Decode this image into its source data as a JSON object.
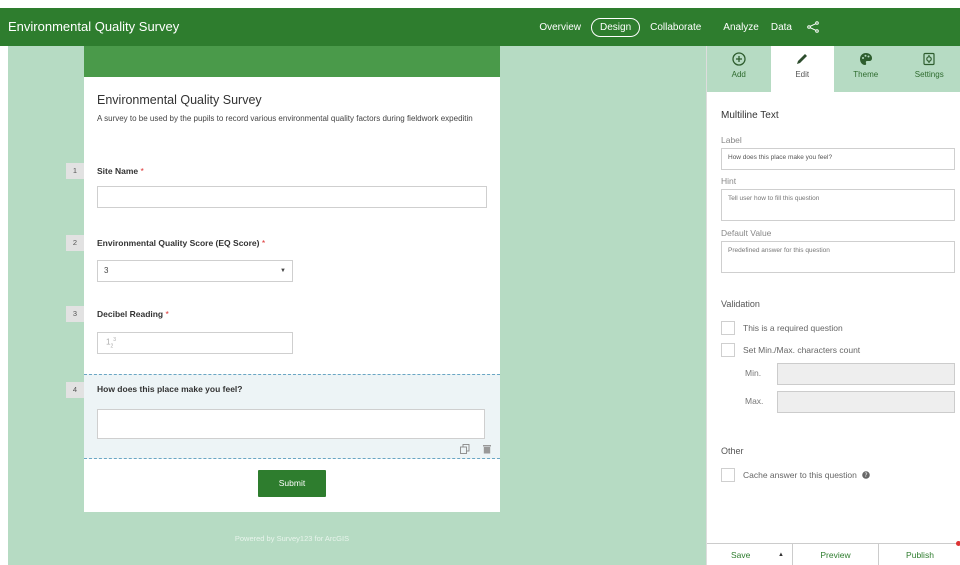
{
  "app": {
    "title": "Environmental Quality Survey"
  },
  "nav": {
    "items": [
      "Overview",
      "Design",
      "Collaborate",
      "Analyze",
      "Data"
    ],
    "active": "Design"
  },
  "form": {
    "title": "Environmental Quality Survey",
    "description": "A survey to be used by the pupils to record various environmental quality factors during fieldwork expeditin",
    "questions": [
      {
        "number": "1",
        "label": "Site Name",
        "required_marker": "*"
      },
      {
        "number": "2",
        "label": "Environmental Quality Score (EQ Score)",
        "required_marker": "*",
        "selected_value": "3"
      },
      {
        "number": "3",
        "label": "Decibel Reading",
        "required_marker": "*",
        "icon": "number-icon"
      },
      {
        "number": "4",
        "label": "How does this place make you feel?"
      }
    ],
    "submit_label": "Submit",
    "powered_by": "Powered by Survey123 for ArcGIS"
  },
  "panel": {
    "tabs": [
      {
        "label": "Add",
        "icon": "plus-circle-icon"
      },
      {
        "label": "Edit",
        "icon": "pencil-icon"
      },
      {
        "label": "Theme",
        "icon": "palette-icon"
      },
      {
        "label": "Settings",
        "icon": "settings-icon"
      }
    ],
    "active_tab": "Edit",
    "section_title": "Multiline Text",
    "label_caption": "Label",
    "label_value": "How does this place make you feel?",
    "hint_caption": "Hint",
    "hint_placeholder": "Tell user how to fill this question",
    "default_caption": "Default Value",
    "default_placeholder": "Predefined answer for this question",
    "validation_title": "Validation",
    "required_check_label": "This is a required question",
    "minmax_check_label": "Set Min./Max. characters count",
    "min_label": "Min.",
    "max_label": "Max.",
    "other_title": "Other",
    "cache_check_label": "Cache answer to this question"
  },
  "bottombar": {
    "save": "Save",
    "preview": "Preview",
    "publish": "Publish"
  },
  "colors": {
    "primary_green": "#2e7d2e",
    "canvas_bg": "#b6dbc3",
    "required": "#d33333"
  }
}
